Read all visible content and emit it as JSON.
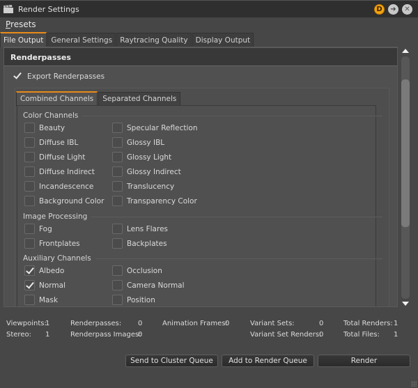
{
  "window": {
    "title": "Render Settings",
    "title_icon": "clapperboard-icon",
    "buttons": [
      {
        "name": "d-badge",
        "glyph": "D",
        "color": "#f2a310"
      },
      {
        "name": "dock-arrow",
        "glyph": "➜"
      },
      {
        "name": "close",
        "glyph": "✕"
      }
    ]
  },
  "menu": {
    "presets_first": "P",
    "presets_rest": "resets"
  },
  "tabs": [
    {
      "label": "File Output",
      "active": true
    },
    {
      "label": "General Settings",
      "active": false
    },
    {
      "label": "Raytracing Quality",
      "active": false
    },
    {
      "label": "Display Output",
      "active": false
    }
  ],
  "accent_color": "#e88a1a",
  "renderpasses": {
    "header": "Renderpasses",
    "export_label": "Export Renderpasses",
    "export_checked": true,
    "subtabs": [
      {
        "label": "Combined Channels",
        "active": true
      },
      {
        "label": "Separated Channels",
        "active": false
      }
    ],
    "groups": [
      {
        "title": "Color Channels",
        "rows": [
          [
            {
              "label": "Beauty",
              "checked": false
            },
            {
              "label": "Specular Reflection",
              "checked": false
            }
          ],
          [
            {
              "label": "Diffuse IBL",
              "checked": false
            },
            {
              "label": "Glossy IBL",
              "checked": false
            }
          ],
          [
            {
              "label": "Diffuse Light",
              "checked": false
            },
            {
              "label": "Glossy Light",
              "checked": false
            }
          ],
          [
            {
              "label": "Diffuse Indirect",
              "checked": false
            },
            {
              "label": "Glossy Indirect",
              "checked": false
            }
          ],
          [
            {
              "label": "Incandescence",
              "checked": false
            },
            {
              "label": "Translucency",
              "checked": false
            }
          ],
          [
            {
              "label": "Background Color",
              "checked": false
            },
            {
              "label": "Transparency Color",
              "checked": false
            }
          ]
        ]
      },
      {
        "title": "Image Processing",
        "rows": [
          [
            {
              "label": "Fog",
              "checked": false
            },
            {
              "label": "Lens Flares",
              "checked": false
            }
          ],
          [
            {
              "label": "Frontplates",
              "checked": false
            },
            {
              "label": "Backplates",
              "checked": false
            }
          ]
        ]
      },
      {
        "title": "Auxiliary Channels",
        "rows": [
          [
            {
              "label": "Albedo",
              "checked": true
            },
            {
              "label": "Occlusion",
              "checked": false
            }
          ],
          [
            {
              "label": "Normal",
              "checked": true
            },
            {
              "label": "Camera Normal",
              "checked": false
            }
          ],
          [
            {
              "label": "Mask",
              "checked": false
            },
            {
              "label": "Position",
              "checked": false
            }
          ]
        ]
      }
    ]
  },
  "stats": {
    "viewpoints_label": "Viewpoints:",
    "viewpoints": "1",
    "stereo_label": "Stereo:",
    "stereo": "1",
    "renderpasses_label": "Renderpasses:",
    "renderpasses": "0",
    "renderpass_images_label": "Renderpass Images:",
    "renderpass_images": "0",
    "animation_frames_label": "Animation Frames:",
    "animation_frames": "0",
    "variant_sets_label": "Variant Sets:",
    "variant_sets": "0",
    "variant_set_renders_label": "Variant Set Renders:",
    "variant_set_renders": "0",
    "total_renders_label": "Total Renders:",
    "total_renders": "1",
    "total_files_label": "Total Files:",
    "total_files": "1"
  },
  "actions": {
    "cluster": "Send to Cluster Queue",
    "queue": "Add to Render Queue",
    "render": "Render"
  },
  "scrollbar": {
    "position_fraction": 0.1,
    "visible_fraction": 0.62
  }
}
